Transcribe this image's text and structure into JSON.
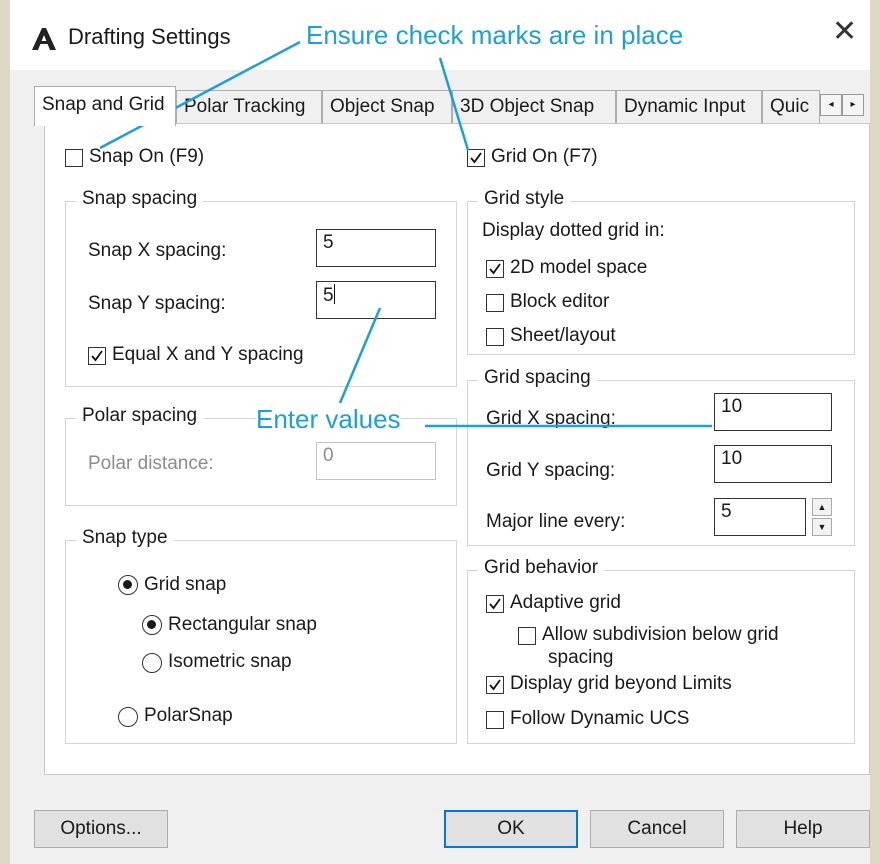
{
  "window": {
    "title": "Drafting Settings",
    "close_glyph": "✕"
  },
  "tabs": [
    "Snap and Grid",
    "Polar Tracking",
    "Object Snap",
    "3D Object Snap",
    "Dynamic Input",
    "Quic"
  ],
  "tab_scroll": {
    "left": "◂",
    "right": "▸"
  },
  "snap": {
    "snap_on": {
      "label": "Snap On (F9)",
      "checked": false
    },
    "spacing_group": "Snap spacing",
    "x_label": "Snap X spacing:",
    "x_value": "5",
    "y_label": "Snap Y spacing:",
    "y_value": "5",
    "equal": {
      "label": "Equal X and Y spacing",
      "checked": true
    }
  },
  "polar": {
    "group": "Polar spacing",
    "distance_label": "Polar distance:",
    "distance_value": "0"
  },
  "snap_type": {
    "group": "Snap type",
    "grid_snap": {
      "label": "Grid snap",
      "selected": true
    },
    "rectangular": {
      "label": "Rectangular snap",
      "selected": true
    },
    "isometric": {
      "label": "Isometric snap",
      "selected": false
    },
    "polarsnap": {
      "label": "PolarSnap",
      "selected": false
    }
  },
  "grid": {
    "grid_on": {
      "label": "Grid On (F7)",
      "checked": true
    },
    "style_group": "Grid style",
    "display_label": "Display dotted grid in:",
    "model_space": {
      "label": "2D model space",
      "checked": true
    },
    "block_editor": {
      "label": "Block editor",
      "checked": false
    },
    "sheet_layout": {
      "label": "Sheet/layout",
      "checked": false
    },
    "spacing_group": "Grid spacing",
    "x_label": "Grid X spacing:",
    "x_value": "10",
    "y_label": "Grid Y spacing:",
    "y_value": "10",
    "major_label": "Major line every:",
    "major_value": "5",
    "behavior_group": "Grid behavior",
    "adaptive": {
      "label": "Adaptive grid",
      "checked": true
    },
    "subdivision": {
      "label": "Allow subdivision below grid",
      "label2": "spacing",
      "checked": false
    },
    "beyond_limits": {
      "label": "Display grid beyond Limits",
      "checked": true
    },
    "dynamic_ucs": {
      "label": "Follow Dynamic UCS",
      "checked": false
    }
  },
  "buttons": {
    "options": "Options...",
    "ok": "OK",
    "cancel": "Cancel",
    "help": "Help"
  },
  "callouts": {
    "top": "Ensure check marks are in place",
    "middle": "Enter values",
    "color": "#1e9fd8"
  }
}
